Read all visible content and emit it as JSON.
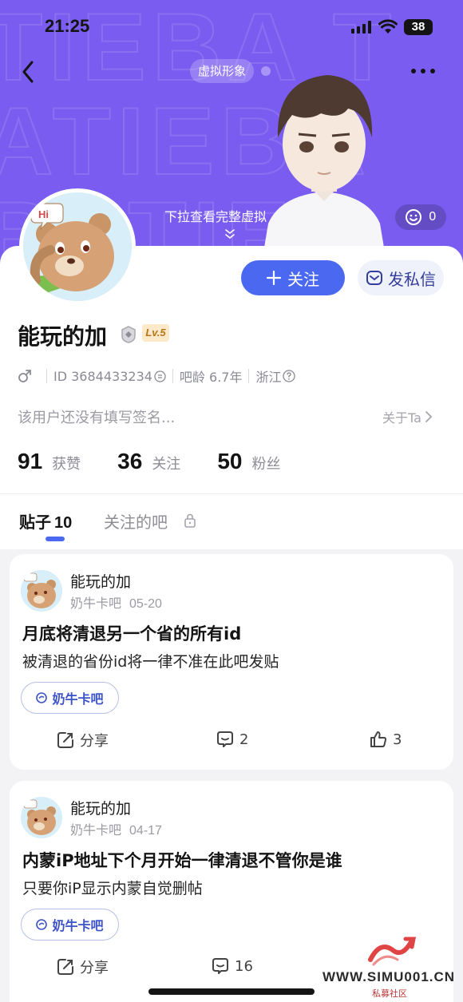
{
  "status_bar": {
    "time": "21:25",
    "battery": "38"
  },
  "header": {
    "avatar_tag": "虚拟形象",
    "pulldown_hint": "下拉查看完整虚拟形象",
    "like_count": "0"
  },
  "profile": {
    "follow_button": "关注",
    "message_button": "发私信",
    "username": "能玩的加",
    "level": "Lv.5",
    "id_label": "ID 3684433234",
    "bar_age": "吧龄 6.7年",
    "location": "浙江",
    "signature": "该用户还没有填写签名...",
    "about": "关于Ta",
    "stats": [
      {
        "num": "91",
        "label": "获赞"
      },
      {
        "num": "36",
        "label": "关注"
      },
      {
        "num": "50",
        "label": "粉丝"
      }
    ]
  },
  "tabs": {
    "posts_label": "贴子",
    "posts_count": "10",
    "followed_bars": "关注的吧"
  },
  "posts": [
    {
      "author": "能玩的加",
      "forum": "奶牛卡吧",
      "date": "05-20",
      "title": "月底将清退另一个省的所有id",
      "body": "被清退的省份id将一律不准在此吧发贴",
      "forum_tag": "奶牛卡吧",
      "share": "分享",
      "comments": "2",
      "likes": "3"
    },
    {
      "author": "能玩的加",
      "forum": "奶牛卡吧",
      "date": "04-17",
      "title": "内蒙iP地址下个月开始一律清退不管你是谁",
      "body": "只要你iP显示内蒙自觉删帖",
      "forum_tag": "奶牛卡吧",
      "share": "分享",
      "comments": "16"
    }
  ],
  "watermark": {
    "url": "WWW.SIMU001.CN",
    "sub": "私募社区"
  },
  "colors": {
    "header": "#7a5df0",
    "accent": "#4a69f0",
    "level_badge": "#fbe9c9"
  }
}
